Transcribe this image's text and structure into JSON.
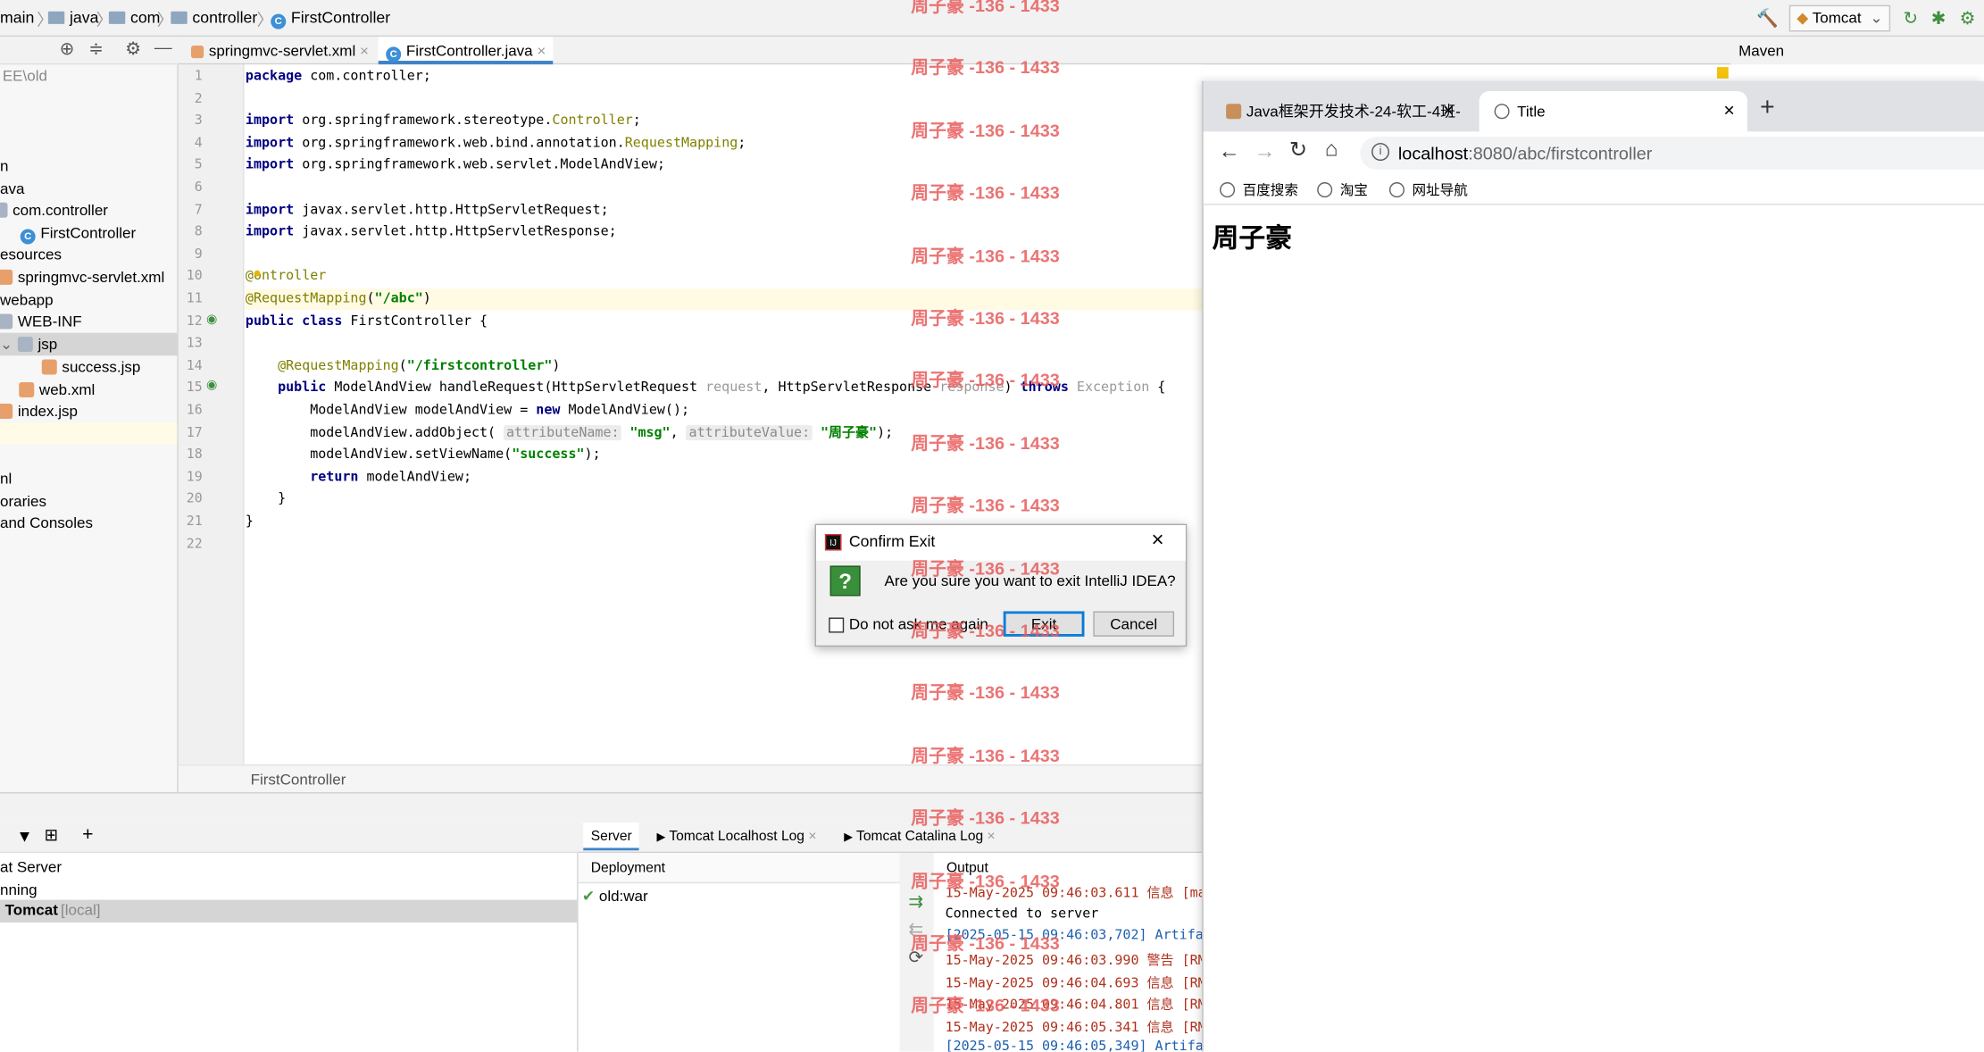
{
  "navbar": {
    "crumbs": [
      "main",
      "java",
      "com",
      "controller",
      "FirstController"
    ],
    "run_config": "Tomcat"
  },
  "project": {
    "items": [
      "EE\\old",
      "n",
      "ava",
      "com.controller",
      "FirstController",
      "esources",
      "springmvc-servlet.xml",
      "webapp",
      "WEB-INF",
      "jsp",
      "success.jsp",
      "web.xml",
      "index.jsp",
      "nl",
      "oraries",
      "and Consoles"
    ]
  },
  "editor": {
    "tabs": [
      "springmvc-servlet.xml",
      "FirstController.java"
    ],
    "active_tab": "FirstController.java",
    "line_numbers": [
      "1",
      "2",
      "3",
      "4",
      "5",
      "6",
      "7",
      "8",
      "9",
      "10",
      "11",
      "12",
      "13",
      "14",
      "15",
      "16",
      "17",
      "18",
      "19",
      "20",
      "21",
      "22"
    ],
    "lines": {
      "l1a": "package",
      "l1b": " com.controller;",
      "l3a": "import",
      "l3b": " org.springframework.stereotype.",
      "l3c": "Controller",
      "l3d": ";",
      "l4a": "import",
      "l4b": " org.springframework.web.bind.annotation.",
      "l4c": "RequestMapping",
      "l4d": ";",
      "l5a": "import",
      "l5b": " org.springframework.web.servlet.ModelAndView;",
      "l7a": "import",
      "l7b": " javax.servlet.http.HttpServletRequest;",
      "l8a": "import",
      "l8b": " javax.servlet.http.HttpServletResponse;",
      "l10a": "@",
      "l10b": "ontroller",
      "l11a": "@RequestMapping",
      "l11b": "(",
      "l11c": "\"/abc\"",
      "l11d": ")",
      "l12a": "public class",
      "l12b": " FirstController {",
      "l14a": "    @RequestMapping",
      "l14b": "(",
      "l14c": "\"/firstcontroller\"",
      "l14d": ")",
      "l15a": "    public",
      "l15b": " ModelAndView handleRequest(HttpServletRequest ",
      "l15c": "request",
      "l15d": ", HttpServletResponse ",
      "l15e": "response",
      "l15f": ") ",
      "l15g": "throws",
      "l15h": " Exception",
      "l15i": " {",
      "l16a": "        ModelAndView modelAndView = ",
      "l16b": "new",
      "l16c": " ModelAndView();",
      "l17a": "        modelAndView.addObject( ",
      "l17b": "attributeName:",
      "l17c": " \"msg\"",
      "l17d": ", ",
      "l17e": "attributeValue:",
      "l17f": " \"周子豪\"",
      "l17g": ");",
      "l18a": "        modelAndView.setViewName(",
      "l18b": "\"success\"",
      "l18c": ");",
      "l19a": "        return",
      "l19b": " modelAndView;",
      "l20a": "    }",
      "l21a": "}"
    },
    "breadcrumb": "FirstController"
  },
  "maven": {
    "title": "Maven"
  },
  "browser": {
    "tabs": [
      "Java框架开发技术-24-软工-4班-",
      "Title"
    ],
    "url_host": "localhost",
    "url_rest": ":8080/abc/firstcontroller",
    "bookmarks": [
      "百度搜索",
      "淘宝",
      "网址导航"
    ],
    "page_heading": "周子豪"
  },
  "services": {
    "tree": [
      "at Server",
      "nning",
      "Tomcat",
      "[local]"
    ],
    "tabs": [
      "Server",
      "Tomcat Localhost Log",
      "Tomcat Catalina Log"
    ],
    "deployment_header": "Deployment",
    "deployment_item": "old:war",
    "output_header": "Output",
    "log": [
      "15-May-2025 09:46:03.611 信息 [ma",
      "Connected to server",
      "[2025-05-15 09:46:03,702] Artifa",
      "15-May-2025 09:46:03.990 警告 [RM",
      "15-May-2025 09:46:04.693 信息 [RM",
      "15-May-2025 09:46:04.801 信息 [RM",
      "15-May-2025 09:46:05.341 信息 [RM",
      "[2025-05-15 09:46:05,349] Artifa"
    ]
  },
  "dialog": {
    "title": "Confirm Exit",
    "message": "Are you sure you want to exit IntelliJ IDEA?",
    "checkbox_label": "Do not ask me again",
    "exit_label": "Exit",
    "cancel_label": "Cancel"
  },
  "watermark": "周子豪 -136 - 1433"
}
